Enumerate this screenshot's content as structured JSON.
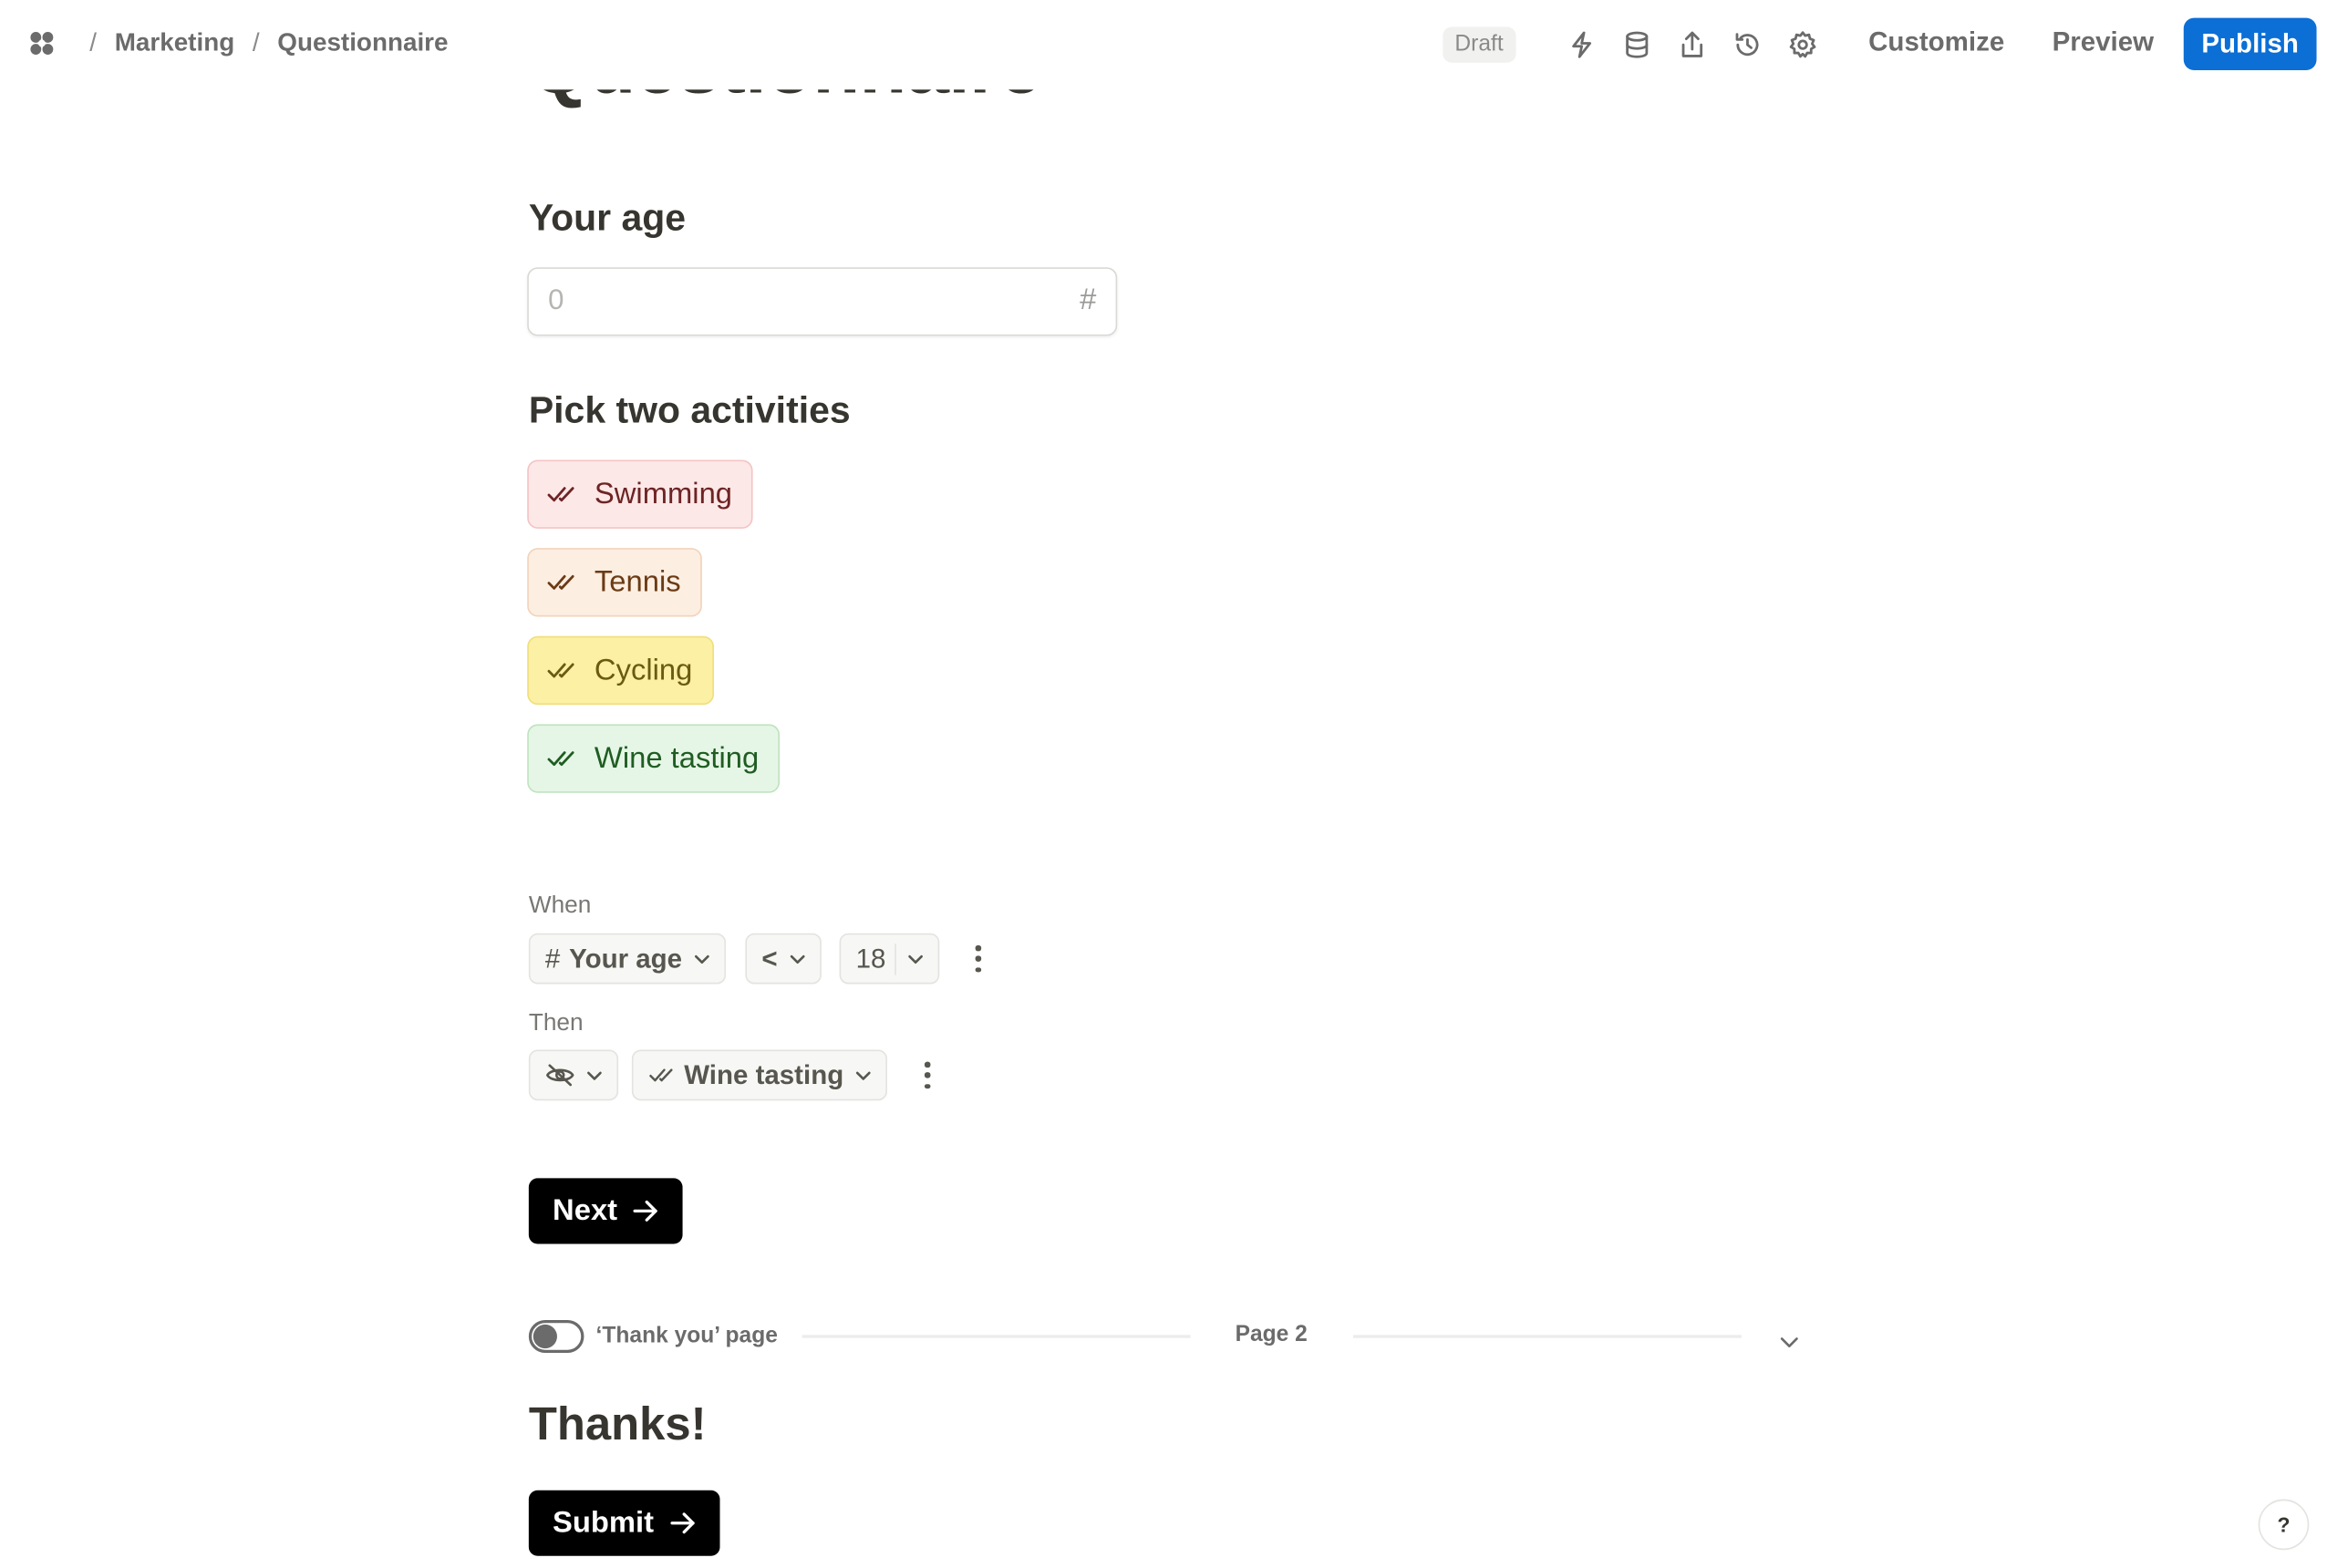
{
  "breadcrumb": {
    "items": [
      "Marketing",
      "Questionnaire"
    ],
    "separator": "/"
  },
  "toolbar": {
    "status_badge": "Draft",
    "icons": [
      "lightning-icon",
      "database-icon",
      "share-icon",
      "history-icon",
      "settings-icon"
    ],
    "customize_label": "Customize",
    "preview_label": "Preview",
    "publish_label": "Publish",
    "publish_color": "#0b6fd6"
  },
  "form": {
    "title": "Questionnaire",
    "age_question": {
      "label": "Your age",
      "placeholder": "0",
      "type_icon": "#"
    },
    "activities_question": {
      "label": "Pick two activities",
      "options": [
        {
          "label": "Swimming",
          "bg": "#fde8e8",
          "border": "#f4c3c3",
          "color": "#6e2424"
        },
        {
          "label": "Tennis",
          "bg": "#fdeee2",
          "border": "#f2d3b9",
          "color": "#6b3b14"
        },
        {
          "label": "Cycling",
          "bg": "#fbf0a3",
          "border": "#f0de7c",
          "color": "#6a5a12"
        },
        {
          "label": "Wine tasting",
          "bg": "#e6f6e6",
          "border": "#bfe3bf",
          "color": "#1f5d22"
        }
      ]
    },
    "logic": {
      "when_label": "When",
      "field": "Your age",
      "field_icon": "#",
      "operator": "<",
      "value": "18",
      "then_label": "Then",
      "action_icon": "eye-off-icon",
      "target": "Wine tasting"
    },
    "next_label": "Next",
    "thank_you_toggle": {
      "label": "‘Thank you’ page",
      "enabled": false
    },
    "page_label": "Page 2",
    "thanks_heading": "Thanks!",
    "submit_label": "Submit"
  },
  "help_label": "?"
}
